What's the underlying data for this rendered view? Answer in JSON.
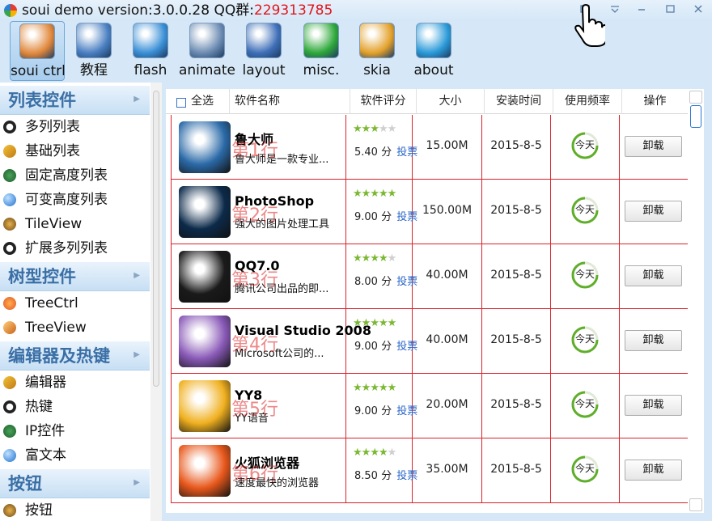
{
  "window": {
    "title": "soui demo version:3.0.0.28 QQ群:",
    "qq_number": "229313785"
  },
  "toolbar": [
    {
      "label": "soui ctrl",
      "active": true,
      "icon": "house-icon",
      "color": "#e0873a"
    },
    {
      "label": "教程",
      "active": false,
      "icon": "tutorial-icon",
      "color": "#4a7fc2"
    },
    {
      "label": "flash",
      "active": false,
      "icon": "flash-icon",
      "color": "#3a8fd6"
    },
    {
      "label": "animate",
      "active": false,
      "icon": "news-icon",
      "color": "#6b8bb2"
    },
    {
      "label": "layout",
      "active": false,
      "icon": "layout-icon",
      "color": "#3f6fb8"
    },
    {
      "label": "misc.",
      "active": false,
      "icon": "misc-icon",
      "color": "#2ea83a"
    },
    {
      "label": "skia",
      "active": false,
      "icon": "skia-icon",
      "color": "#e3a12b"
    },
    {
      "label": "about",
      "active": false,
      "icon": "about-icon",
      "color": "#2a9ad8"
    }
  ],
  "nav": {
    "groups": [
      {
        "label": "列表控件",
        "items": [
          {
            "label": "多列列表",
            "icon": "panda-icon"
          },
          {
            "label": "基础列表",
            "icon": "broom-icon"
          },
          {
            "label": "固定高度列表",
            "icon": "bug-icon"
          },
          {
            "label": "可变高度列表",
            "icon": "globe-icon"
          },
          {
            "label": "TileView",
            "icon": "tree-icon"
          },
          {
            "label": "扩展多列列表",
            "icon": "panda-icon"
          }
        ]
      },
      {
        "label": "树型控件",
        "items": [
          {
            "label": "TreeCtrl",
            "icon": "star-icon"
          },
          {
            "label": "TreeView",
            "icon": "pen-icon"
          }
        ]
      },
      {
        "label": "编辑器及热键",
        "items": [
          {
            "label": "编辑器",
            "icon": "broom-icon"
          },
          {
            "label": "热键",
            "icon": "panda-icon"
          },
          {
            "label": "IP控件",
            "icon": "bug-icon"
          },
          {
            "label": "富文本",
            "icon": "globe-icon"
          }
        ]
      },
      {
        "label": "按钮",
        "items": [
          {
            "label": "按钮",
            "icon": "tree-icon"
          }
        ]
      }
    ]
  },
  "list": {
    "headers": {
      "select_all": "全选",
      "name": "软件名称",
      "rating": "软件评分",
      "size": "大小",
      "install_time": "安装时间",
      "frequency": "使用频率",
      "action": "操作"
    },
    "vote_label": "投票",
    "score_unit": "分",
    "rows": [
      {
        "name": "鲁大师",
        "desc": "鲁大师是一款专业...",
        "tag": "第1行",
        "stars": 3,
        "score": "5.40",
        "size": "15.00M",
        "date": "2015-8-5",
        "freq": "今天",
        "action": "卸载",
        "icon_color": "#2b6aa8"
      },
      {
        "name": "PhotoShop",
        "desc": "强大的图片处理工具",
        "tag": "第2行",
        "stars": 5,
        "score": "9.00",
        "size": "150.00M",
        "date": "2015-8-5",
        "freq": "今天",
        "action": "卸载",
        "icon_color": "#0c2a4a"
      },
      {
        "name": "QQ7.0",
        "desc": "腾讯公司出品的即...",
        "tag": "第3行",
        "stars": 4,
        "score": "8.00",
        "size": "40.00M",
        "date": "2015-8-5",
        "freq": "今天",
        "action": "卸载",
        "icon_color": "#1a1a1a"
      },
      {
        "name": "Visual Studio 2008",
        "desc": "Microsoft公司的...",
        "tag": "第4行",
        "stars": 5,
        "score": "9.00",
        "size": "40.00M",
        "date": "2015-8-5",
        "freq": "今天",
        "action": "卸载",
        "icon_color": "#8a5ab8"
      },
      {
        "name": "YY8",
        "desc": "YY语音",
        "tag": "第5行",
        "stars": 5,
        "score": "9.00",
        "size": "20.00M",
        "date": "2015-8-5",
        "freq": "今天",
        "action": "卸载",
        "icon_color": "#f0b020"
      },
      {
        "name": "火狐浏览器",
        "desc": "速度最快的浏览器",
        "tag": "第6行",
        "stars": 4,
        "score": "8.50",
        "size": "35.00M",
        "date": "2015-8-5",
        "freq": "今天",
        "action": "卸载",
        "icon_color": "#e8581c"
      }
    ]
  },
  "colors": {
    "accent": "#3a6fa6",
    "row_border": "#d9232a",
    "star_on": "#7bb832",
    "title_qq": "#e0161c"
  }
}
